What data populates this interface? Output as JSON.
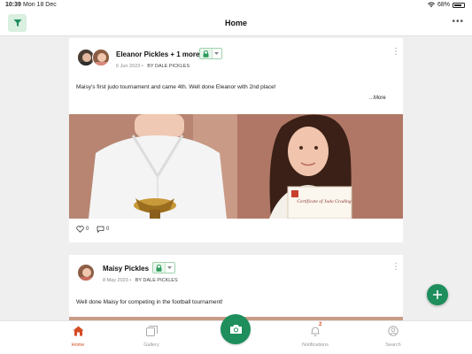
{
  "status_bar": {
    "time": "10:39",
    "date": "Mon 18 Dec",
    "battery": "68%"
  },
  "nav": {
    "title": "Home",
    "more_icon": "ellipsis-icon",
    "filter_icon": "filter-icon"
  },
  "posts": [
    {
      "author": "Eleanor Pickles + 1 more",
      "date": "6 Jun 2023",
      "separator": "•",
      "by": "BY DALE PICKLES",
      "privacy_icon": "lock-icon",
      "text": "Maisy's first judo tournament and came 4th. Well done Eleanor with 2nd place!",
      "more_label": "...More",
      "certificate_title": "Certificate of Judo Grading",
      "likes": "0",
      "comments": "0"
    },
    {
      "author": "Maisy Pickles",
      "date": "8 May 2023",
      "separator": "•",
      "by": "BY DALE PICKLES",
      "privacy_icon": "lock-icon",
      "text": "Well done Maisy for competing in the football tournament!"
    }
  ],
  "tabs": [
    {
      "label": "Home",
      "icon": "home-icon",
      "active": true
    },
    {
      "label": "Gallery",
      "icon": "gallery-icon",
      "active": false
    },
    {
      "label": "Notifications",
      "icon": "bell-icon",
      "active": false,
      "badge": "2"
    },
    {
      "label": "Search",
      "icon": "search-icon",
      "active": false
    }
  ],
  "colors": {
    "brand_green": "#1d8e5c",
    "active_tab": "#d64b24",
    "background": "#efefef"
  }
}
